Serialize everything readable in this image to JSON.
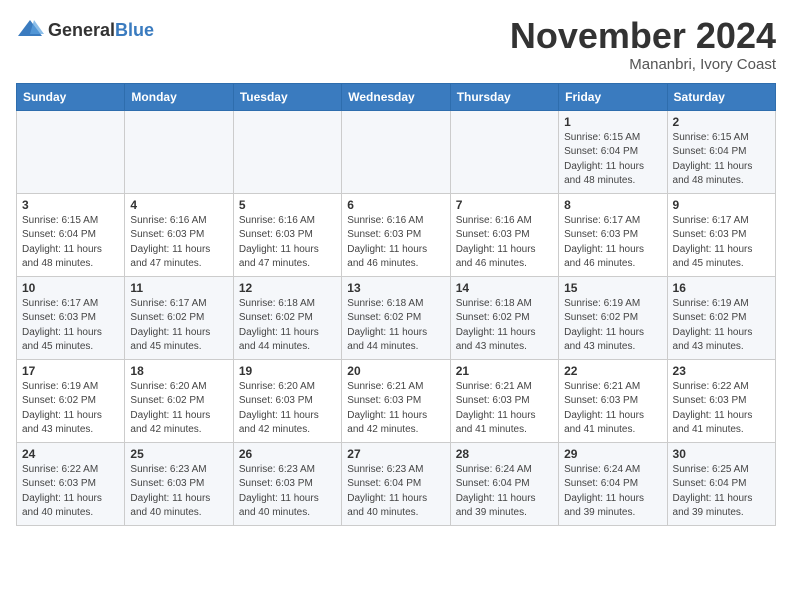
{
  "logo": {
    "general": "General",
    "blue": "Blue"
  },
  "header": {
    "month": "November 2024",
    "location": "Mananbri, Ivory Coast"
  },
  "weekdays": [
    "Sunday",
    "Monday",
    "Tuesday",
    "Wednesday",
    "Thursday",
    "Friday",
    "Saturday"
  ],
  "weeks": [
    [
      {
        "day": "",
        "info": ""
      },
      {
        "day": "",
        "info": ""
      },
      {
        "day": "",
        "info": ""
      },
      {
        "day": "",
        "info": ""
      },
      {
        "day": "",
        "info": ""
      },
      {
        "day": "1",
        "info": "Sunrise: 6:15 AM\nSunset: 6:04 PM\nDaylight: 11 hours\nand 48 minutes."
      },
      {
        "day": "2",
        "info": "Sunrise: 6:15 AM\nSunset: 6:04 PM\nDaylight: 11 hours\nand 48 minutes."
      }
    ],
    [
      {
        "day": "3",
        "info": "Sunrise: 6:15 AM\nSunset: 6:04 PM\nDaylight: 11 hours\nand 48 minutes."
      },
      {
        "day": "4",
        "info": "Sunrise: 6:16 AM\nSunset: 6:03 PM\nDaylight: 11 hours\nand 47 minutes."
      },
      {
        "day": "5",
        "info": "Sunrise: 6:16 AM\nSunset: 6:03 PM\nDaylight: 11 hours\nand 47 minutes."
      },
      {
        "day": "6",
        "info": "Sunrise: 6:16 AM\nSunset: 6:03 PM\nDaylight: 11 hours\nand 46 minutes."
      },
      {
        "day": "7",
        "info": "Sunrise: 6:16 AM\nSunset: 6:03 PM\nDaylight: 11 hours\nand 46 minutes."
      },
      {
        "day": "8",
        "info": "Sunrise: 6:17 AM\nSunset: 6:03 PM\nDaylight: 11 hours\nand 46 minutes."
      },
      {
        "day": "9",
        "info": "Sunrise: 6:17 AM\nSunset: 6:03 PM\nDaylight: 11 hours\nand 45 minutes."
      }
    ],
    [
      {
        "day": "10",
        "info": "Sunrise: 6:17 AM\nSunset: 6:03 PM\nDaylight: 11 hours\nand 45 minutes."
      },
      {
        "day": "11",
        "info": "Sunrise: 6:17 AM\nSunset: 6:02 PM\nDaylight: 11 hours\nand 45 minutes."
      },
      {
        "day": "12",
        "info": "Sunrise: 6:18 AM\nSunset: 6:02 PM\nDaylight: 11 hours\nand 44 minutes."
      },
      {
        "day": "13",
        "info": "Sunrise: 6:18 AM\nSunset: 6:02 PM\nDaylight: 11 hours\nand 44 minutes."
      },
      {
        "day": "14",
        "info": "Sunrise: 6:18 AM\nSunset: 6:02 PM\nDaylight: 11 hours\nand 43 minutes."
      },
      {
        "day": "15",
        "info": "Sunrise: 6:19 AM\nSunset: 6:02 PM\nDaylight: 11 hours\nand 43 minutes."
      },
      {
        "day": "16",
        "info": "Sunrise: 6:19 AM\nSunset: 6:02 PM\nDaylight: 11 hours\nand 43 minutes."
      }
    ],
    [
      {
        "day": "17",
        "info": "Sunrise: 6:19 AM\nSunset: 6:02 PM\nDaylight: 11 hours\nand 43 minutes."
      },
      {
        "day": "18",
        "info": "Sunrise: 6:20 AM\nSunset: 6:02 PM\nDaylight: 11 hours\nand 42 minutes."
      },
      {
        "day": "19",
        "info": "Sunrise: 6:20 AM\nSunset: 6:03 PM\nDaylight: 11 hours\nand 42 minutes."
      },
      {
        "day": "20",
        "info": "Sunrise: 6:21 AM\nSunset: 6:03 PM\nDaylight: 11 hours\nand 42 minutes."
      },
      {
        "day": "21",
        "info": "Sunrise: 6:21 AM\nSunset: 6:03 PM\nDaylight: 11 hours\nand 41 minutes."
      },
      {
        "day": "22",
        "info": "Sunrise: 6:21 AM\nSunset: 6:03 PM\nDaylight: 11 hours\nand 41 minutes."
      },
      {
        "day": "23",
        "info": "Sunrise: 6:22 AM\nSunset: 6:03 PM\nDaylight: 11 hours\nand 41 minutes."
      }
    ],
    [
      {
        "day": "24",
        "info": "Sunrise: 6:22 AM\nSunset: 6:03 PM\nDaylight: 11 hours\nand 40 minutes."
      },
      {
        "day": "25",
        "info": "Sunrise: 6:23 AM\nSunset: 6:03 PM\nDaylight: 11 hours\nand 40 minutes."
      },
      {
        "day": "26",
        "info": "Sunrise: 6:23 AM\nSunset: 6:03 PM\nDaylight: 11 hours\nand 40 minutes."
      },
      {
        "day": "27",
        "info": "Sunrise: 6:23 AM\nSunset: 6:04 PM\nDaylight: 11 hours\nand 40 minutes."
      },
      {
        "day": "28",
        "info": "Sunrise: 6:24 AM\nSunset: 6:04 PM\nDaylight: 11 hours\nand 39 minutes."
      },
      {
        "day": "29",
        "info": "Sunrise: 6:24 AM\nSunset: 6:04 PM\nDaylight: 11 hours\nand 39 minutes."
      },
      {
        "day": "30",
        "info": "Sunrise: 6:25 AM\nSunset: 6:04 PM\nDaylight: 11 hours\nand 39 minutes."
      }
    ]
  ]
}
